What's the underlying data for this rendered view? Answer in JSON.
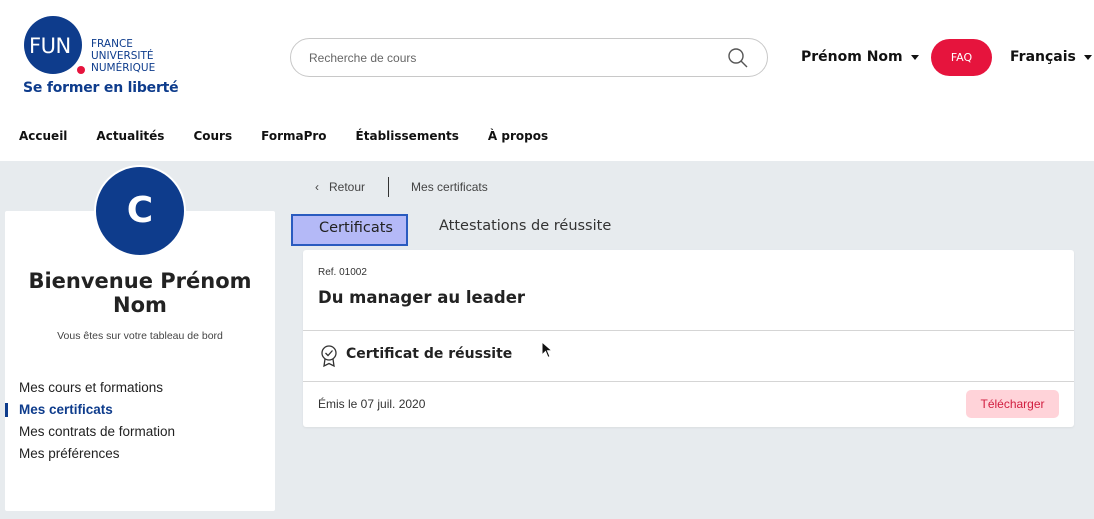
{
  "brand": {
    "logo_mark": "FUN",
    "logo_lines": [
      "FRANCE",
      "UNIVERSITÉ",
      "NUMÉRIQUE"
    ],
    "tagline": "Se former en liberté",
    "primary_color": "#0e3c8c",
    "accent_color": "#e6143d"
  },
  "header": {
    "search_placeholder": "Recherche de cours",
    "search_icon": "search-icon",
    "user_name": "Prénom Nom",
    "faq_label": "FAQ",
    "language": "Français"
  },
  "nav": {
    "items": [
      "Accueil",
      "Actualités",
      "Cours",
      "FormaPro",
      "Établissements",
      "À propos"
    ]
  },
  "sidebar": {
    "avatar_initial": "C",
    "welcome": "Bienvenue Prénom Nom",
    "subtitle": "Vous êtes sur votre tableau de bord",
    "menu": [
      {
        "label": "Mes cours et formations",
        "active": false
      },
      {
        "label": "Mes certificats",
        "active": true
      },
      {
        "label": "Mes contrats de formation",
        "active": false
      },
      {
        "label": "Mes préférences",
        "active": false
      }
    ]
  },
  "breadcrumb": {
    "back_label": "Retour",
    "current": "Mes certificats"
  },
  "tabs": {
    "certificates": "Certificats",
    "attestations": "Attestations de réussite"
  },
  "certificate": {
    "ref": "Ref. 01002",
    "course_title": "Du manager au leader",
    "type_icon": "award-icon",
    "type": "Certificat de réussite",
    "issued": "Émis le 07 juil. 2020",
    "download_label": "Télécharger"
  }
}
